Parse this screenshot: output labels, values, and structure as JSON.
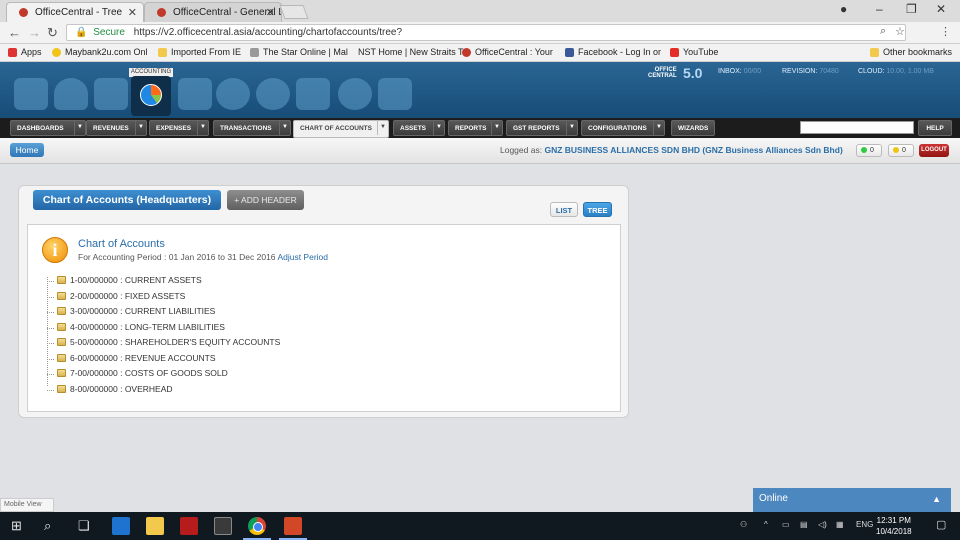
{
  "browser": {
    "tabs": [
      {
        "title": "OfficeCentral - Tree"
      },
      {
        "title": "OfficeCentral - General L"
      }
    ],
    "url": "https://v2.officecentral.asia/accounting/chartofaccounts/tree?",
    "secure_label": "Secure",
    "bookmarks": [
      {
        "label": "Apps"
      },
      {
        "label": "Maybank2u.com Onl"
      },
      {
        "label": "Imported From IE"
      },
      {
        "label": "The Star Online | Mal"
      },
      {
        "label": "NST Home | New Straits T"
      },
      {
        "label": "OfficeCentral : Your"
      },
      {
        "label": "Facebook - Log In or"
      },
      {
        "label": "YouTube"
      },
      {
        "label": "Other bookmarks"
      }
    ]
  },
  "app_header": {
    "active_module_label": "ACCOUNTING",
    "brand_line1": "OFFICE",
    "brand_line2": "CENTRAL",
    "version": "5.0",
    "badges": [
      {
        "label": "INBOX:",
        "value": "00/00"
      },
      {
        "label": "REVISION:",
        "value": "70480"
      },
      {
        "label": "CLOUD:",
        "value": "10.00, 1.00 MB"
      }
    ]
  },
  "menu": {
    "items": [
      {
        "label": "DASHBOARDS"
      },
      {
        "label": "REVENUES"
      },
      {
        "label": "EXPENSES"
      },
      {
        "label": "TRANSACTIONS"
      },
      {
        "label": "CHART OF ACCOUNTS"
      },
      {
        "label": "ASSETS"
      },
      {
        "label": "REPORTS"
      },
      {
        "label": "GST REPORTS"
      },
      {
        "label": "CONFIGURATIONS"
      },
      {
        "label": "WIZARDS"
      }
    ],
    "help_label": "HELP"
  },
  "subbar": {
    "home_label": "Home",
    "logged_as_label": "Logged as:",
    "company": "GNZ BUSINESS ALLIANCES SDN BHD (GNZ Business Alliances Sdn Bhd)",
    "green_count": "0",
    "yellow_count": "0",
    "logout_label": "LOGOUT"
  },
  "panel": {
    "title": "Chart of Accounts (Headquarters)",
    "add_header_label": "+ ADD HEADER",
    "list_label": "LIST",
    "tree_label": "TREE",
    "coa_title": "Chart of Accounts",
    "period_text": "For Accounting Period : 01 Jan 2016 to 31 Dec 2016",
    "adjust_label": "Adjust Period",
    "tree_items": [
      {
        "label": "1-00/000000 : CURRENT ASSETS"
      },
      {
        "label": "2-00/000000 : FIXED ASSETS"
      },
      {
        "label": "3-00/000000 : CURRENT LIABILITIES"
      },
      {
        "label": "4-00/000000 : LONG-TERM LIABILITIES"
      },
      {
        "label": "5-00/000000 : SHAREHOLDER'S EQUITY ACCOUNTS"
      },
      {
        "label": "6-00/000000 : REVENUE ACCOUNTS"
      },
      {
        "label": "7-00/000000 : COSTS OF GOODS SOLD"
      },
      {
        "label": "8-00/000000 : OVERHEAD"
      }
    ]
  },
  "widgets": {
    "mobile_view_label": "Mobile View",
    "online_label": "Online"
  },
  "taskbar": {
    "lang": "ENG",
    "time": "12:31 PM",
    "date": "10/4/2018"
  },
  "colors": {
    "header_blue": "#1f5a88",
    "accent_blue": "#2a6ea8",
    "logout_red": "#b22222"
  }
}
